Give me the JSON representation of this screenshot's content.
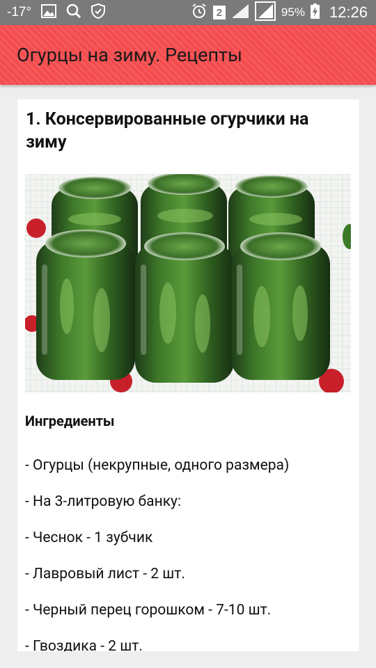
{
  "status_bar": {
    "temperature": "-17°",
    "sim_number": "2",
    "battery": "95%",
    "time": "12:26"
  },
  "app_bar": {
    "title": "Огурцы на зиму. Рецепты"
  },
  "recipe": {
    "title": "1. Консервированные огурчики на зиму",
    "ingredients_heading": "Ингредиенты",
    "ingredients": [
      "- Огурцы (некрупные, одного размера)",
      "- На 3-литровую банку:",
      "- Чеснок - 1 зубчик",
      "- Лавровый лист - 2 шт.",
      "- Черный перец горошком - 7-10 шт.",
      "- Гвоздика - 2 шт."
    ]
  },
  "colors": {
    "app_bar": "#f44c4e",
    "status_bar": "#7a7a7a",
    "background": "#eeeeee",
    "card": "#ffffff"
  },
  "icons": [
    "image-icon",
    "search-icon",
    "shield-icon",
    "alarm-icon",
    "signal-icon",
    "battery-charging-icon"
  ]
}
